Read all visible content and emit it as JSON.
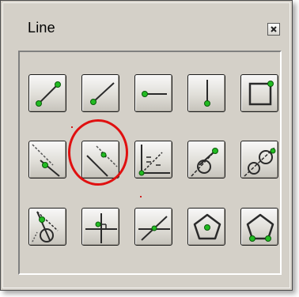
{
  "window": {
    "title": "Line",
    "close_glyph": "✕"
  },
  "watermark": "",
  "tools": [
    {
      "row": 1,
      "icon": "segment-two-points-icon"
    },
    {
      "row": 1,
      "icon": "ray-icon"
    },
    {
      "row": 1,
      "icon": "horizontal-line-icon"
    },
    {
      "row": 1,
      "icon": "vertical-line-icon"
    },
    {
      "row": 1,
      "icon": "rectangle-icon"
    },
    {
      "row": 2,
      "icon": "parallel-line-icon"
    },
    {
      "row": 2,
      "icon": "parallel-offset-line-icon",
      "highlighted": true
    },
    {
      "row": 2,
      "icon": "angle-bisector-icon"
    },
    {
      "row": 2,
      "icon": "tangent-line-circle-icon"
    },
    {
      "row": 2,
      "icon": "tangent-two-circles-icon"
    },
    {
      "row": 3,
      "icon": "tangent-through-point-icon"
    },
    {
      "row": 3,
      "icon": "perpendicular-line-icon"
    },
    {
      "row": 3,
      "icon": "line-at-angle-icon"
    },
    {
      "row": 3,
      "icon": "inscribed-polygon-icon"
    },
    {
      "row": 3,
      "icon": "polygon-icon"
    }
  ],
  "colors": {
    "panel": "#d4d0c8",
    "icon_line": "#2a2a2a",
    "icon_point": "#22bb22",
    "highlight": "#e01010"
  }
}
